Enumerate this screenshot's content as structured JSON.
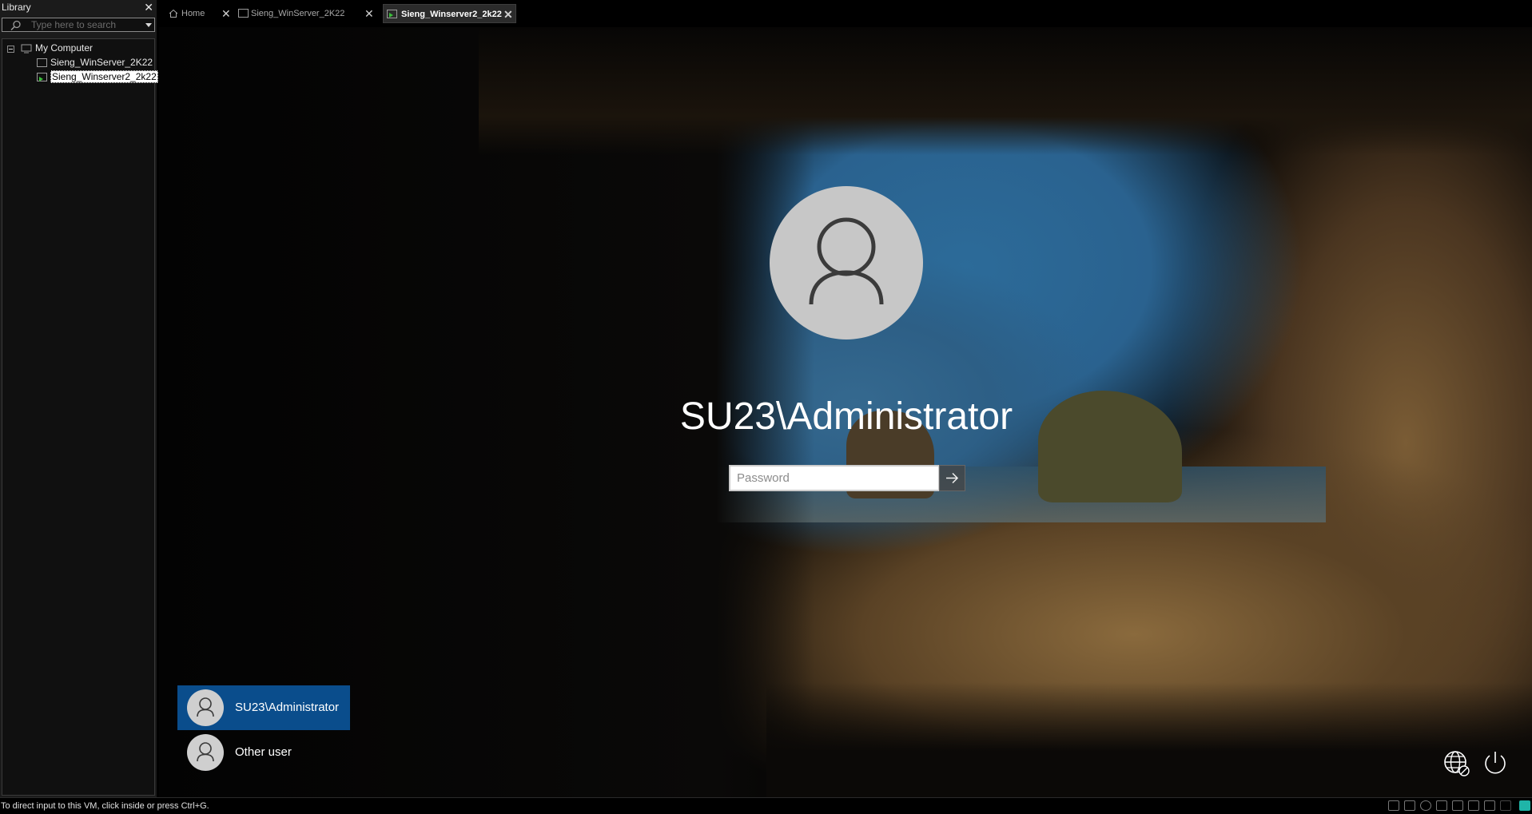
{
  "library": {
    "title": "Library",
    "search_placeholder": "Type here to search",
    "tree": {
      "root_label": "My Computer",
      "items": [
        {
          "label": "Sieng_WinServer_2K22",
          "selected": false
        },
        {
          "label": "Sieng_Winserver2_2k22",
          "selected": true
        }
      ]
    }
  },
  "tabs": [
    {
      "label": "Home",
      "icon": "home-icon",
      "active": false
    },
    {
      "label": "Sieng_WinServer_2K22",
      "icon": "vm-icon",
      "active": false
    },
    {
      "label": "Sieng_Winserver2_2k22",
      "icon": "vm-running-icon",
      "active": true
    }
  ],
  "login": {
    "username": "SU23\\Administrator",
    "password_placeholder": "Password",
    "submit_icon": "arrow-right-icon",
    "users": [
      {
        "label": "SU23\\Administrator",
        "selected": true
      },
      {
        "label": "Other user",
        "selected": false
      }
    ],
    "ease_icon": "network-icon",
    "power_icon": "power-icon"
  },
  "statusbar": {
    "hint": "To direct input to this VM, click inside or press Ctrl+G."
  },
  "colors": {
    "selected_user": "#0a4d8c",
    "avatar": "#c7c7c7",
    "panel": "#1b1b1b"
  }
}
